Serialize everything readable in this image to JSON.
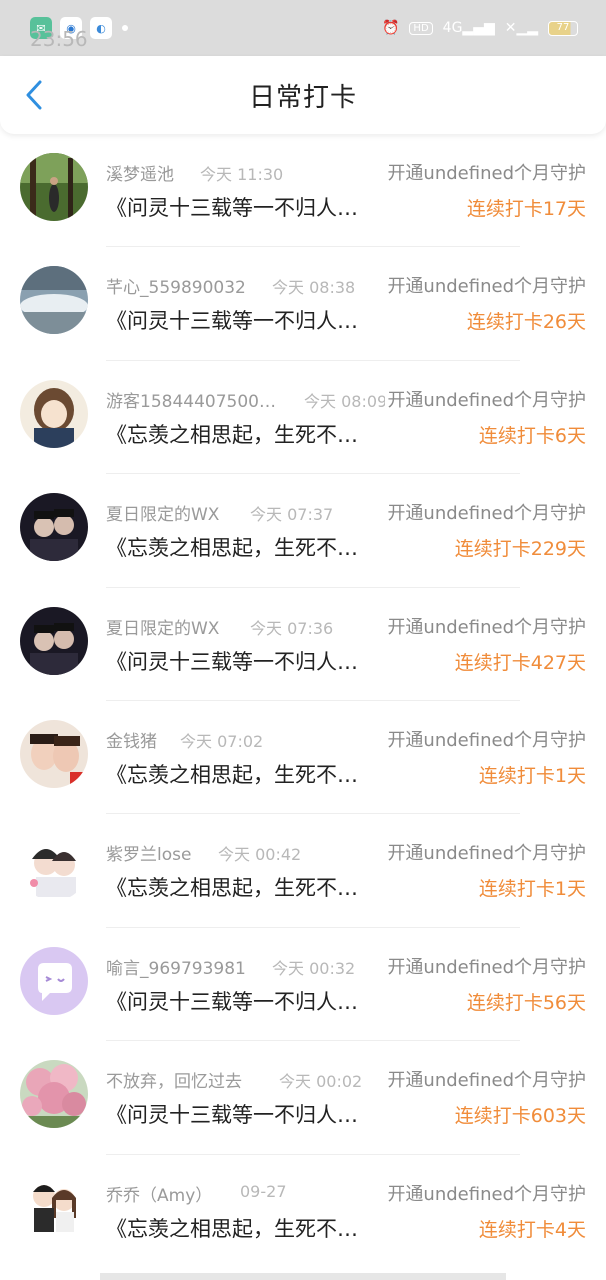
{
  "status_bar": {
    "time": "23:56",
    "battery": "77",
    "network": "4G",
    "hd": "HD"
  },
  "header": {
    "title": "日常打卡"
  },
  "rows": [
    {
      "name": "溪梦遥池",
      "time": "今天 11:30",
      "guard": "开通undefined个月守护",
      "message": "《问灵十三载等一不归人…",
      "streak": "连续打卡17天",
      "avatar": "forest-photo"
    },
    {
      "name": "芊心_559890032",
      "time": "今天 08:38",
      "guard": "开通undefined个月守护",
      "message": "《问灵十三载等一不归人…",
      "streak": "连续打卡26天",
      "avatar": "waterfall-photo"
    },
    {
      "name": "游客15844407500…",
      "time": "今天 08:09",
      "guard": "开通undefined个月守护",
      "message": "《忘羡之相思起，生死不…",
      "streak": "连续打卡6天",
      "avatar": "anime-girl"
    },
    {
      "name": "夏日限定的WX",
      "time": "今天 07:37",
      "guard": "开通undefined个月守护",
      "message": "《忘羡之相思起，生死不…",
      "streak": "连续打卡229天",
      "avatar": "couple-dark-photo"
    },
    {
      "name": "夏日限定的WX",
      "time": "今天 07:36",
      "guard": "开通undefined个月守护",
      "message": "《问灵十三载等一不归人…",
      "streak": "连续打卡427天",
      "avatar": "couple-dark-photo"
    },
    {
      "name": "金钱猪",
      "time": "今天 07:02",
      "guard": "开通undefined个月守护",
      "message": "《忘羡之相思起，生死不…",
      "streak": "连续打卡1天",
      "avatar": "selfie-photo"
    },
    {
      "name": "紫罗兰lose",
      "time": "今天 00:42",
      "guard": "开通undefined个月守护",
      "message": "《忘羡之相思起，生死不…",
      "streak": "连续打卡1天",
      "avatar": "chibi-couple"
    },
    {
      "name": "喻言_969793981",
      "time": "今天 00:32",
      "guard": "开通undefined个月守护",
      "message": "《问灵十三载等一不归人…",
      "streak": "连续打卡56天",
      "avatar": "default-chat"
    },
    {
      "name": "不放弃，回忆过去",
      "time": "今天 00:02",
      "guard": "开通undefined个月守护",
      "message": "《问灵十三载等一不归人…",
      "streak": "连续打卡603天",
      "avatar": "blossom-photo"
    },
    {
      "name": "乔乔（Amy）",
      "time": "09-27",
      "guard": "开通undefined个月守护",
      "message": "《忘羡之相思起，生死不…",
      "streak": "连续打卡4天",
      "avatar": "cartoon-couple"
    }
  ],
  "colors": {
    "accent_blue": "#2f8fe0",
    "streak_orange": "#f08c3a",
    "status_bar_bg": "#dcdcdc"
  }
}
